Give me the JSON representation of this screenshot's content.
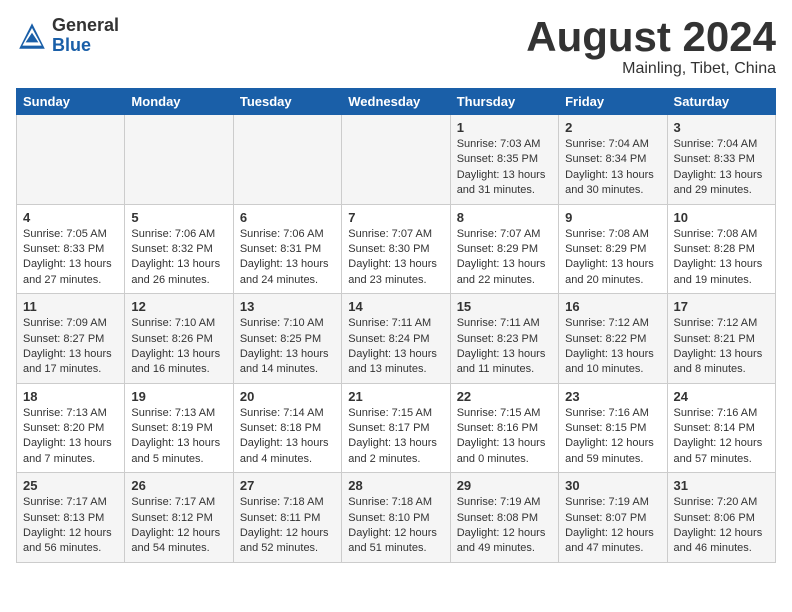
{
  "header": {
    "logo_general": "General",
    "logo_blue": "Blue",
    "month": "August 2024",
    "location": "Mainling, Tibet, China"
  },
  "days_of_week": [
    "Sunday",
    "Monday",
    "Tuesday",
    "Wednesday",
    "Thursday",
    "Friday",
    "Saturday"
  ],
  "weeks": [
    {
      "row_parity": "odd",
      "days": [
        {
          "number": "",
          "data": ""
        },
        {
          "number": "",
          "data": ""
        },
        {
          "number": "",
          "data": ""
        },
        {
          "number": "",
          "data": ""
        },
        {
          "number": "1",
          "data": "Sunrise: 7:03 AM\nSunset: 8:35 PM\nDaylight: 13 hours\nand 31 minutes."
        },
        {
          "number": "2",
          "data": "Sunrise: 7:04 AM\nSunset: 8:34 PM\nDaylight: 13 hours\nand 30 minutes."
        },
        {
          "number": "3",
          "data": "Sunrise: 7:04 AM\nSunset: 8:33 PM\nDaylight: 13 hours\nand 29 minutes."
        }
      ]
    },
    {
      "row_parity": "even",
      "days": [
        {
          "number": "4",
          "data": "Sunrise: 7:05 AM\nSunset: 8:33 PM\nDaylight: 13 hours\nand 27 minutes."
        },
        {
          "number": "5",
          "data": "Sunrise: 7:06 AM\nSunset: 8:32 PM\nDaylight: 13 hours\nand 26 minutes."
        },
        {
          "number": "6",
          "data": "Sunrise: 7:06 AM\nSunset: 8:31 PM\nDaylight: 13 hours\nand 24 minutes."
        },
        {
          "number": "7",
          "data": "Sunrise: 7:07 AM\nSunset: 8:30 PM\nDaylight: 13 hours\nand 23 minutes."
        },
        {
          "number": "8",
          "data": "Sunrise: 7:07 AM\nSunset: 8:29 PM\nDaylight: 13 hours\nand 22 minutes."
        },
        {
          "number": "9",
          "data": "Sunrise: 7:08 AM\nSunset: 8:29 PM\nDaylight: 13 hours\nand 20 minutes."
        },
        {
          "number": "10",
          "data": "Sunrise: 7:08 AM\nSunset: 8:28 PM\nDaylight: 13 hours\nand 19 minutes."
        }
      ]
    },
    {
      "row_parity": "odd",
      "days": [
        {
          "number": "11",
          "data": "Sunrise: 7:09 AM\nSunset: 8:27 PM\nDaylight: 13 hours\nand 17 minutes."
        },
        {
          "number": "12",
          "data": "Sunrise: 7:10 AM\nSunset: 8:26 PM\nDaylight: 13 hours\nand 16 minutes."
        },
        {
          "number": "13",
          "data": "Sunrise: 7:10 AM\nSunset: 8:25 PM\nDaylight: 13 hours\nand 14 minutes."
        },
        {
          "number": "14",
          "data": "Sunrise: 7:11 AM\nSunset: 8:24 PM\nDaylight: 13 hours\nand 13 minutes."
        },
        {
          "number": "15",
          "data": "Sunrise: 7:11 AM\nSunset: 8:23 PM\nDaylight: 13 hours\nand 11 minutes."
        },
        {
          "number": "16",
          "data": "Sunrise: 7:12 AM\nSunset: 8:22 PM\nDaylight: 13 hours\nand 10 minutes."
        },
        {
          "number": "17",
          "data": "Sunrise: 7:12 AM\nSunset: 8:21 PM\nDaylight: 13 hours\nand 8 minutes."
        }
      ]
    },
    {
      "row_parity": "even",
      "days": [
        {
          "number": "18",
          "data": "Sunrise: 7:13 AM\nSunset: 8:20 PM\nDaylight: 13 hours\nand 7 minutes."
        },
        {
          "number": "19",
          "data": "Sunrise: 7:13 AM\nSunset: 8:19 PM\nDaylight: 13 hours\nand 5 minutes."
        },
        {
          "number": "20",
          "data": "Sunrise: 7:14 AM\nSunset: 8:18 PM\nDaylight: 13 hours\nand 4 minutes."
        },
        {
          "number": "21",
          "data": "Sunrise: 7:15 AM\nSunset: 8:17 PM\nDaylight: 13 hours\nand 2 minutes."
        },
        {
          "number": "22",
          "data": "Sunrise: 7:15 AM\nSunset: 8:16 PM\nDaylight: 13 hours\nand 0 minutes."
        },
        {
          "number": "23",
          "data": "Sunrise: 7:16 AM\nSunset: 8:15 PM\nDaylight: 12 hours\nand 59 minutes."
        },
        {
          "number": "24",
          "data": "Sunrise: 7:16 AM\nSunset: 8:14 PM\nDaylight: 12 hours\nand 57 minutes."
        }
      ]
    },
    {
      "row_parity": "odd",
      "days": [
        {
          "number": "25",
          "data": "Sunrise: 7:17 AM\nSunset: 8:13 PM\nDaylight: 12 hours\nand 56 minutes."
        },
        {
          "number": "26",
          "data": "Sunrise: 7:17 AM\nSunset: 8:12 PM\nDaylight: 12 hours\nand 54 minutes."
        },
        {
          "number": "27",
          "data": "Sunrise: 7:18 AM\nSunset: 8:11 PM\nDaylight: 12 hours\nand 52 minutes."
        },
        {
          "number": "28",
          "data": "Sunrise: 7:18 AM\nSunset: 8:10 PM\nDaylight: 12 hours\nand 51 minutes."
        },
        {
          "number": "29",
          "data": "Sunrise: 7:19 AM\nSunset: 8:08 PM\nDaylight: 12 hours\nand 49 minutes."
        },
        {
          "number": "30",
          "data": "Sunrise: 7:19 AM\nSunset: 8:07 PM\nDaylight: 12 hours\nand 47 minutes."
        },
        {
          "number": "31",
          "data": "Sunrise: 7:20 AM\nSunset: 8:06 PM\nDaylight: 12 hours\nand 46 minutes."
        }
      ]
    }
  ]
}
